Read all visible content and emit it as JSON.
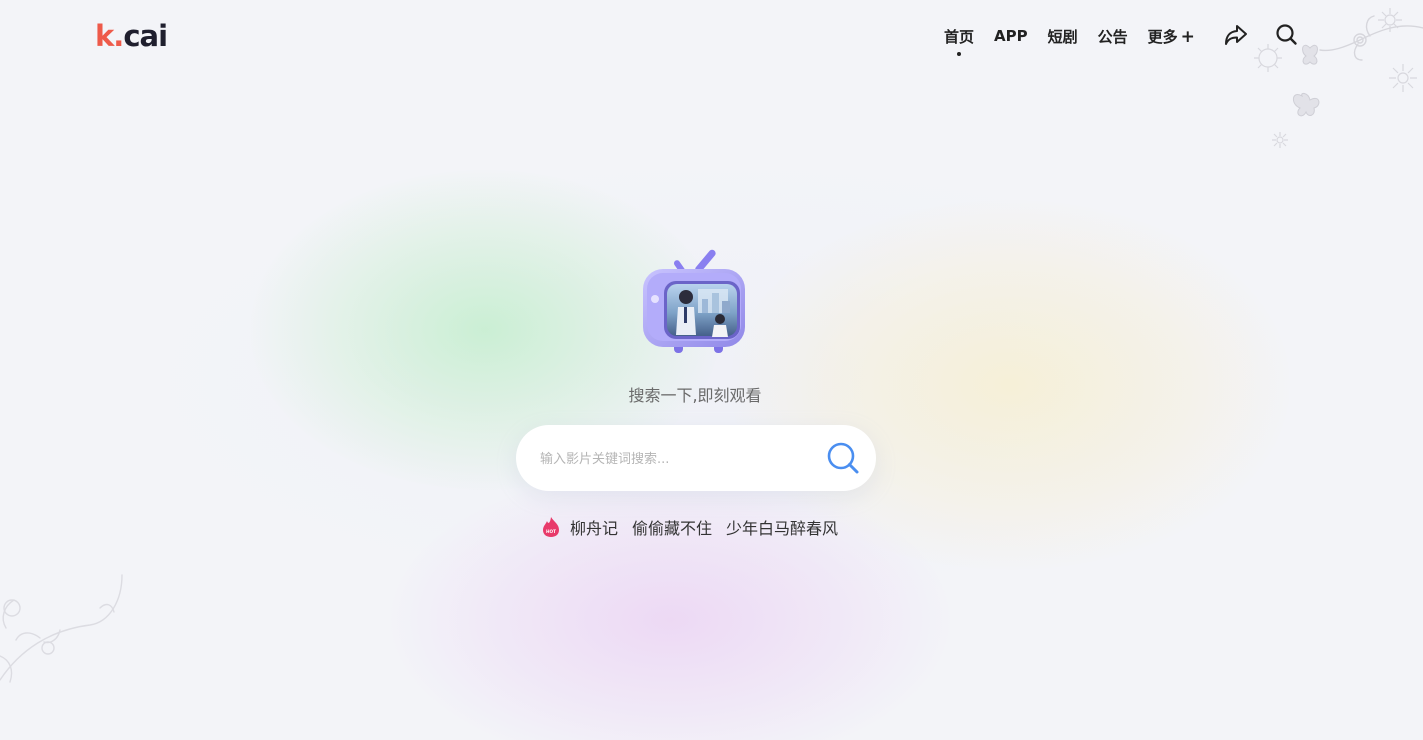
{
  "header": {
    "logo": {
      "k": "k",
      "dot": ".",
      "rest": "cai"
    },
    "nav": [
      {
        "label": "首页",
        "active": true
      },
      {
        "label": "APP"
      },
      {
        "label": "短剧"
      },
      {
        "label": "公告"
      },
      {
        "label": "更多"
      }
    ],
    "more_symbol": "+",
    "icons": [
      "share-icon",
      "search-icon"
    ]
  },
  "main": {
    "tagline": "搜索一下,即刻观看",
    "search": {
      "placeholder": "输入影片关键词搜索..."
    },
    "hot_badge": "HOT",
    "hot_keywords": [
      "柳舟记",
      "偷偷藏不住",
      "少年白马醉春风"
    ]
  },
  "colors": {
    "brand_red": "#ee5a4a",
    "hot_pink": "#e83a6a",
    "search_blue": "#4a8ef0",
    "tv_purple": "#a59af0"
  }
}
